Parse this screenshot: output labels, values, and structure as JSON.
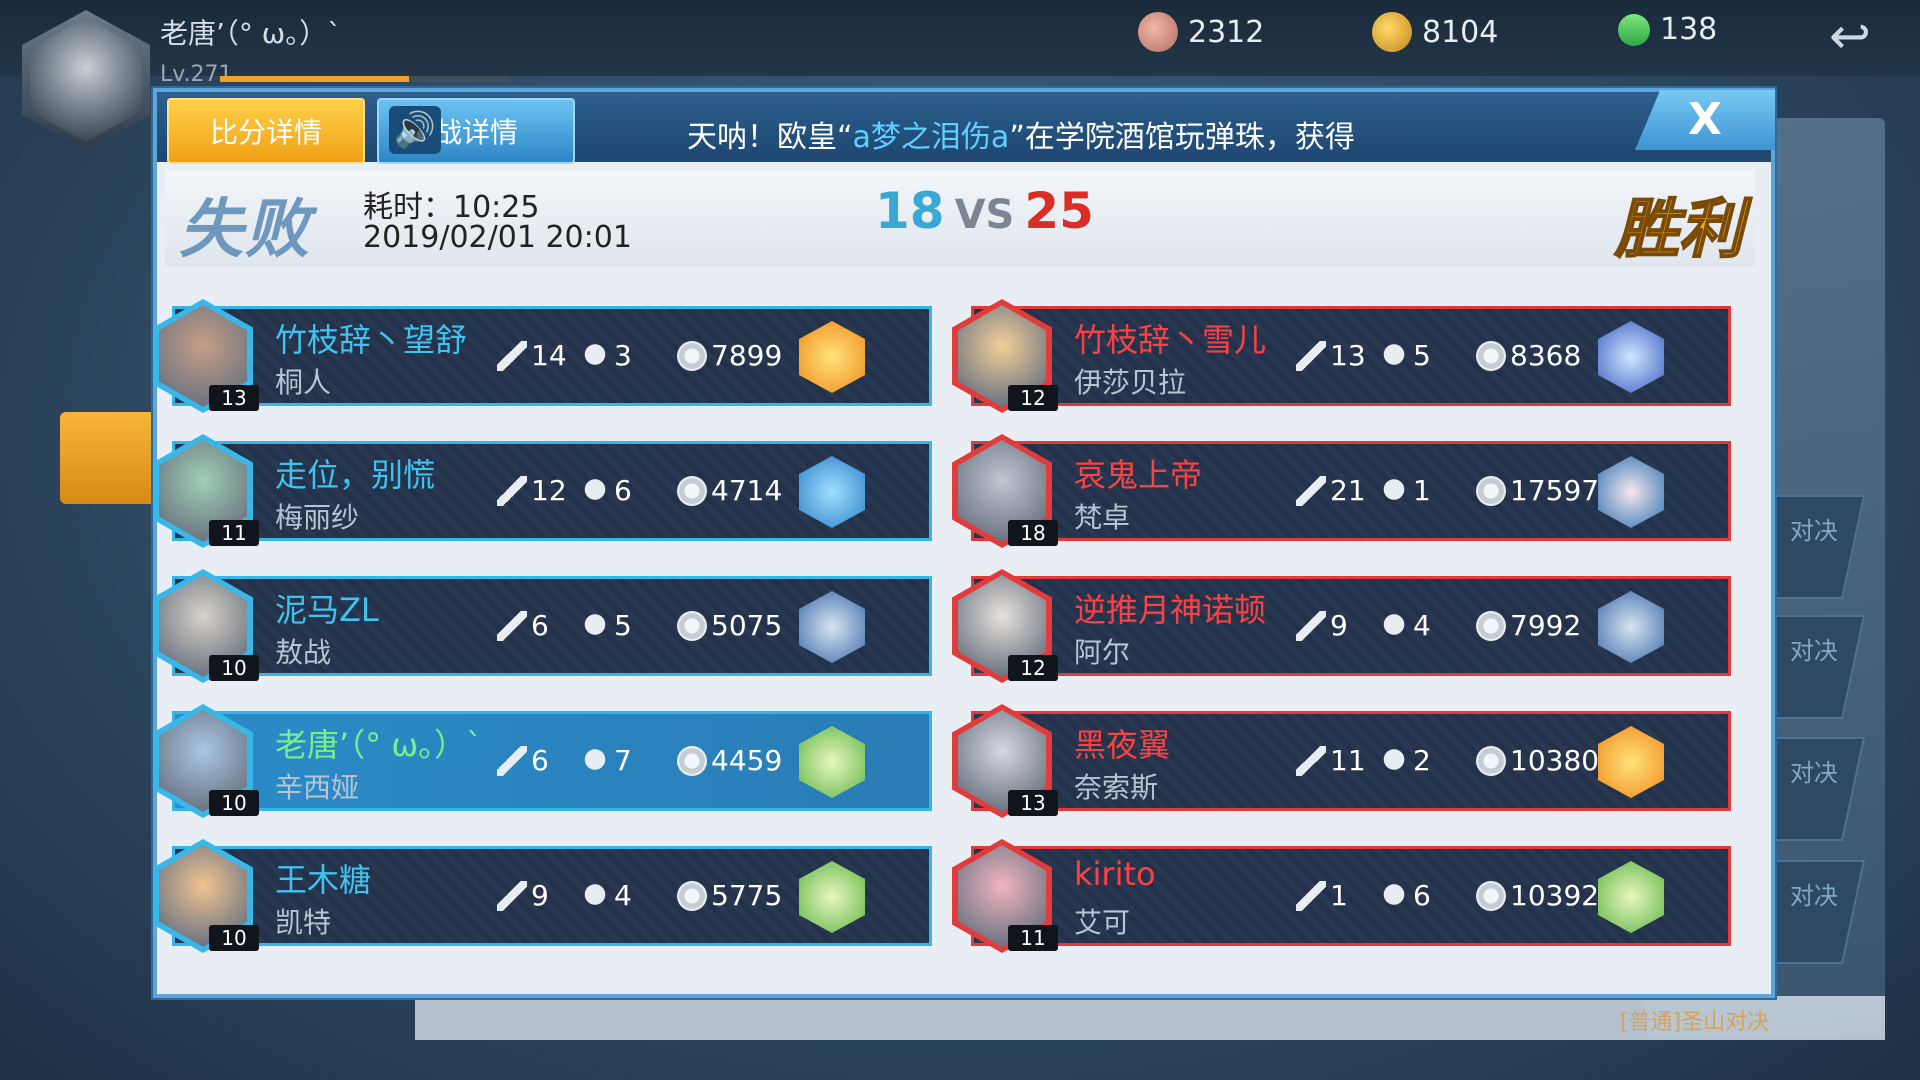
{
  "topbar": {
    "player_name": "老唐’（° ω。）`",
    "level": "Lv.271",
    "xp_fraction": 0.65,
    "shells": "2312",
    "coins": "8104",
    "gems": "138"
  },
  "tabs": {
    "score_details": "比分详情",
    "battle_details": "战详情"
  },
  "marquee": {
    "prefix": "天呐！欧皇“",
    "highlight": "a梦之泪伤a",
    "suffix": "”在学院酒馆玩弹珠，获得"
  },
  "close_label": "X",
  "summary": {
    "left_result": "失败",
    "right_result": "胜利",
    "duration_label": "耗时：10:25",
    "datetime": "2019/02/01 20:01",
    "blue_score": "18",
    "vs": "VS",
    "red_score": "25"
  },
  "colors": {
    "blue_team": "#36b6e6",
    "red_team": "#e03a3a",
    "self_row": "#2b8cc8",
    "accent_gold": "#f2a620"
  },
  "blue_team": [
    {
      "name": "竹枝辞丶望舒",
      "hero": "桐人",
      "level": "13",
      "kills": "14",
      "deaths": "3",
      "gold": "7899",
      "equip_icon": "fire-gear-icon"
    },
    {
      "name": "走位，别慌",
      "hero": "梅丽纱",
      "level": "11",
      "kills": "12",
      "deaths": "6",
      "gold": "4714",
      "equip_icon": "water-gear-icon"
    },
    {
      "name": "泥马ZL",
      "hero": "敖战",
      "level": "10",
      "kills": "6",
      "deaths": "5",
      "gold": "5075",
      "equip_icon": "wolf-gear-icon"
    },
    {
      "name": "老唐’（° ω。）`",
      "hero": "辛西娅",
      "level": "10",
      "kills": "6",
      "deaths": "7",
      "gold": "4459",
      "equip_icon": "leaf-gear-icon"
    },
    {
      "name": "王木糖",
      "hero": "凯特",
      "level": "10",
      "kills": "9",
      "deaths": "4",
      "gold": "5775",
      "equip_icon": "leaf-gear-icon"
    }
  ],
  "red_team": [
    {
      "name": "竹枝辞丶雪儿",
      "hero": "伊莎贝拉",
      "level": "12",
      "kills": "13",
      "deaths": "5",
      "gold": "8368",
      "equip_icon": "blade-gear-icon"
    },
    {
      "name": "哀鬼上帝",
      "hero": "梵卓",
      "level": "18",
      "kills": "21",
      "deaths": "1",
      "gold": "17597",
      "equip_icon": "rose-gear-icon"
    },
    {
      "name": "逆推月神诺顿",
      "hero": "阿尔",
      "level": "12",
      "kills": "9",
      "deaths": "4",
      "gold": "7992",
      "equip_icon": "wolf-gear-icon"
    },
    {
      "name": "黑夜翼",
      "hero": "奈索斯",
      "level": "13",
      "kills": "11",
      "deaths": "2",
      "gold": "10380",
      "equip_icon": "fire-gear-icon"
    },
    {
      "name": "kirito",
      "hero": "艾可",
      "level": "11",
      "kills": "1",
      "deaths": "6",
      "gold": "10392",
      "equip_icon": "leaf-gear-icon"
    }
  ],
  "background": {
    "side_buttons": [
      "对决",
      "对决",
      "对决",
      "对决"
    ],
    "bottom_text": "[普通]圣山对决"
  }
}
